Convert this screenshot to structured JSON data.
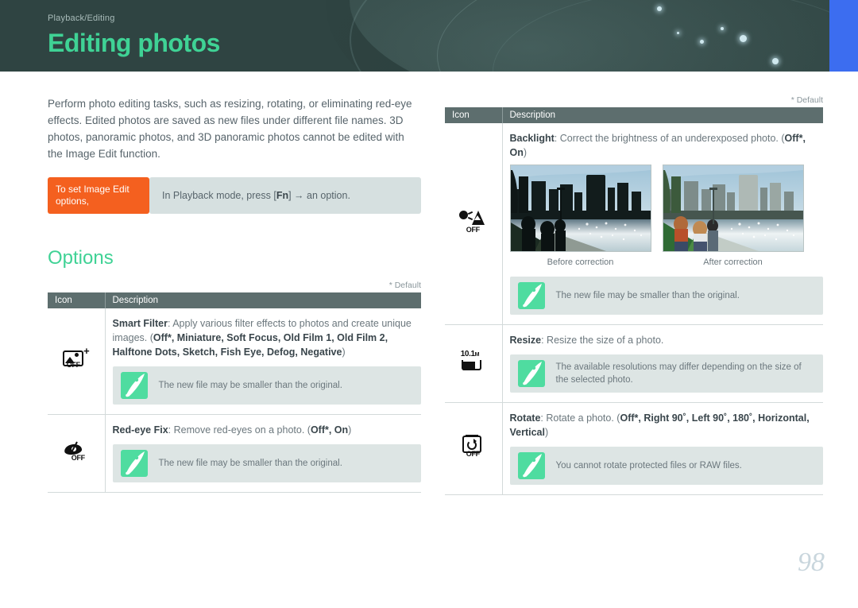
{
  "banner": {
    "kicker": "Playback/Editing",
    "title": "Editing photos",
    "bg_color": "#2f4442",
    "title_color": "#3fd295",
    "accent_color": "#3c6df0"
  },
  "intro": {
    "paragraph": "Perform photo editing tasks, such as resizing, rotating, or eliminating red-eye effects. Edited photos are saved as new files under different file names. 3D photos, panoramic photos, and 3D panoramic photos cannot be edited with the Image Edit function."
  },
  "callout": {
    "tag": "To set Image Edit options,",
    "text_before": "In Playback mode, press [",
    "key": "Fn",
    "text_after": "] → an option.",
    "tag_color": "#f4601f",
    "body_color": "#d6e0e0"
  },
  "section": {
    "title": "Options"
  },
  "table": {
    "default_note": "* Default",
    "headers": {
      "icon": "Icon",
      "description": "Description"
    },
    "header_bg": "#5d6e6e"
  },
  "left_rows": [
    {
      "icon_name": "smart-filter-icon",
      "icon_label": "OFF",
      "title": "Smart Filter",
      "desc_plain": ": Apply various filter effects to photos and create unique images. (",
      "options": "Off*, Miniature, Soft Focus, Old Film 1, Old Film 2, Halftone Dots, Sketch, Fish Eye, Defog, Negative",
      "desc_tail": ")",
      "note": "The new file may be smaller than the original."
    },
    {
      "icon_name": "red-eye-fix-icon",
      "icon_label": "OFF",
      "title": "Red-eye Fix",
      "desc_plain": ": Remove red-eyes on a photo. (",
      "options": "Off*, On",
      "desc_tail": ")",
      "note": "The new file may be smaller than the original."
    }
  ],
  "right_rows": [
    {
      "icon_name": "backlight-icon",
      "icon_label": "OFF",
      "title": "Backlight",
      "desc_plain": ": Correct the brightness of an underexposed photo. (",
      "options": "Off*, On",
      "desc_tail": ")",
      "photos": [
        {
          "caption": "Before correction",
          "variant": "before"
        },
        {
          "caption": "After correction",
          "variant": "after"
        }
      ],
      "note": "The new file may be smaller than the original."
    },
    {
      "icon_name": "resize-icon",
      "icon_label": "10.1",
      "icon_label_sub": "M",
      "title": "Resize",
      "desc_plain": ": Resize the size of a photo.",
      "options": "",
      "desc_tail": "",
      "note": "The available resolutions may differ depending on the size of the selected photo."
    },
    {
      "icon_name": "rotate-icon",
      "icon_label": "OFF",
      "title": "Rotate",
      "desc_plain": ": Rotate a photo. (",
      "options": "Off*, Right 90˚, Left 90˚, 180˚, Horizontal, Vertical",
      "desc_tail": ")",
      "note": "You cannot rotate protected files or RAW files."
    }
  ],
  "footer": {
    "page_number": "98"
  }
}
